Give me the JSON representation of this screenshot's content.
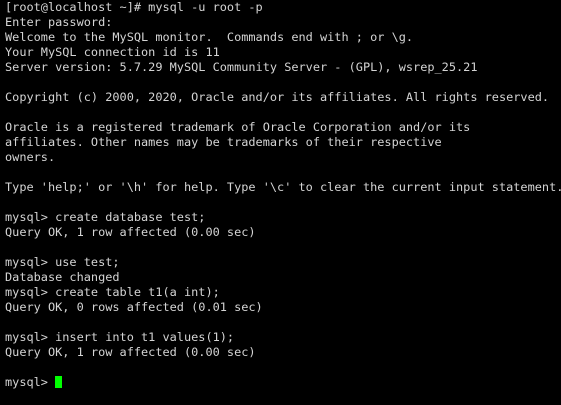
{
  "terminal": {
    "lines": [
      "[root@localhost ~]# mysql -u root -p",
      "Enter password:",
      "Welcome to the MySQL monitor.  Commands end with ; or \\g.",
      "Your MySQL connection id is 11",
      "Server version: 5.7.29 MySQL Community Server - (GPL), wsrep_25.21",
      "",
      "Copyright (c) 2000, 2020, Oracle and/or its affiliates. All rights reserved.",
      "",
      "Oracle is a registered trademark of Oracle Corporation and/or its",
      "affiliates. Other names may be trademarks of their respective",
      "owners.",
      "",
      "Type 'help;' or '\\h' for help. Type '\\c' to clear the current input statement.",
      "",
      "mysql> create database test;",
      "Query OK, 1 row affected (0.00 sec)",
      "",
      "mysql> use test;",
      "Database changed",
      "mysql> create table t1(a int);",
      "Query OK, 0 rows affected (0.01 sec)",
      "",
      "mysql> insert into t1 values(1);",
      "Query OK, 1 row affected (0.00 sec)",
      "",
      "mysql> "
    ],
    "colors": {
      "background": "#000000",
      "text": "#d4d4d4",
      "cursor": "#00ff00"
    }
  }
}
